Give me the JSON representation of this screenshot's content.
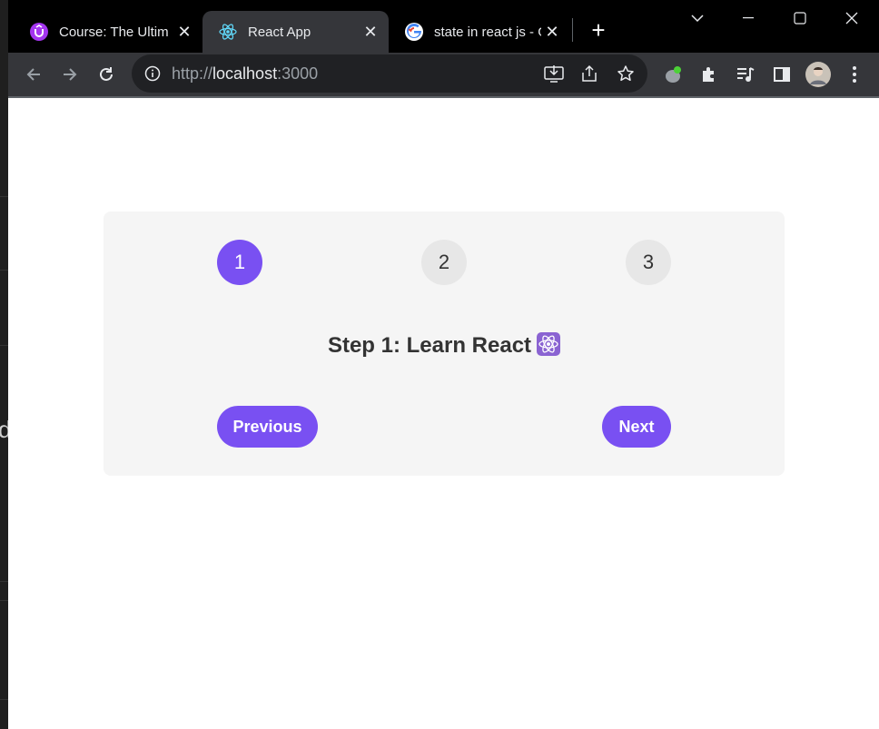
{
  "browser": {
    "tabs": [
      {
        "title": "Course: The Ultim",
        "active": false
      },
      {
        "title": "React App",
        "active": true
      },
      {
        "title": "state in react js - G",
        "active": false
      }
    ],
    "address": {
      "scheme": "http://",
      "host": "localhost",
      "port": ":3000"
    }
  },
  "app": {
    "steps": [
      "1",
      "2",
      "3"
    ],
    "active_step": 1,
    "message": "Step 1: Learn React",
    "previous_label": "Previous",
    "next_label": "Next"
  },
  "colors": {
    "accent": "#7950f2",
    "card_bg": "#f5f5f5",
    "inactive_step": "#e7e7e7"
  }
}
